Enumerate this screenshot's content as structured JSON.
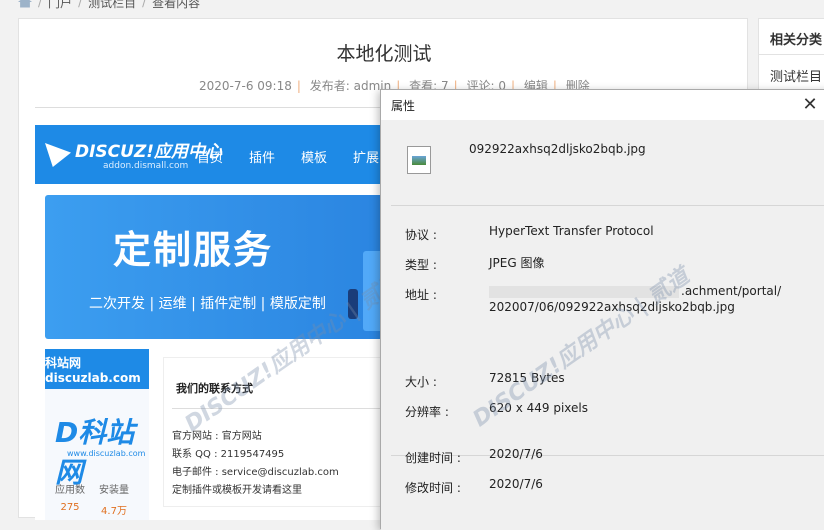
{
  "breadcrumb": {
    "items": [
      "门户",
      "测试栏目",
      "查看内容"
    ]
  },
  "article": {
    "title": "本地化测试",
    "date": "2020-7-6 09:18",
    "author": "发布者: admin",
    "views": "查看: 7",
    "comments": "评论: 0",
    "edit": "编辑",
    "delete": "删除"
  },
  "banner": {
    "logo": "DISCUZ!应用中心",
    "logo_sub": "addon.dismall.com",
    "nav": [
      "首页",
      "插件",
      "模板",
      "扩展"
    ],
    "hero_title": "定制服务",
    "hero_sub": "二次开发 | 运维 | 插件定制 | 模版定制",
    "card_title": "科站网discuzlab.com",
    "card_logo": "D科站网",
    "card_logo_sub": "www.discuzlab.com",
    "stats": [
      {
        "label": "应用数",
        "value": "275"
      },
      {
        "label": "安装量",
        "value": "4.7万"
      }
    ],
    "contact_title": "我们的联系方式",
    "contact_lines": [
      "官方网站 : 官方网站",
      "联系 QQ : 2119547495",
      "电子邮件 : service@discuzlab.com",
      "定制插件或模板开发请看这里"
    ],
    "watermark": "DISCUZ!应用中心 | 贰道"
  },
  "sidebar": {
    "title": "相关分类",
    "items": [
      "测试栏目"
    ]
  },
  "dialog": {
    "title": "属性",
    "close": "✕",
    "file_name": "092922axhsq2dljsko2bqb.jpg",
    "protocol_label": "协议 :",
    "protocol_value": "HyperText Transfer Protocol",
    "type_label": "类型 :",
    "type_value": "JPEG 图像",
    "address_label": "地址 :",
    "address_line1": ".achment/portal/",
    "address_line2": "202007/06/092922axhsq2dljsko2bqb.jpg",
    "size_label": "大小 :",
    "size_value": "72815 Bytes",
    "resolution_label": "分辨率 :",
    "resolution_value": "620 x 449 pixels",
    "created_label": "创建时间 :",
    "created_value": "2020/7/6",
    "modified_label": "修改时间 :",
    "modified_value": "2020/7/6",
    "watermark": "DISCUZ!应用中心 | 贰道"
  }
}
